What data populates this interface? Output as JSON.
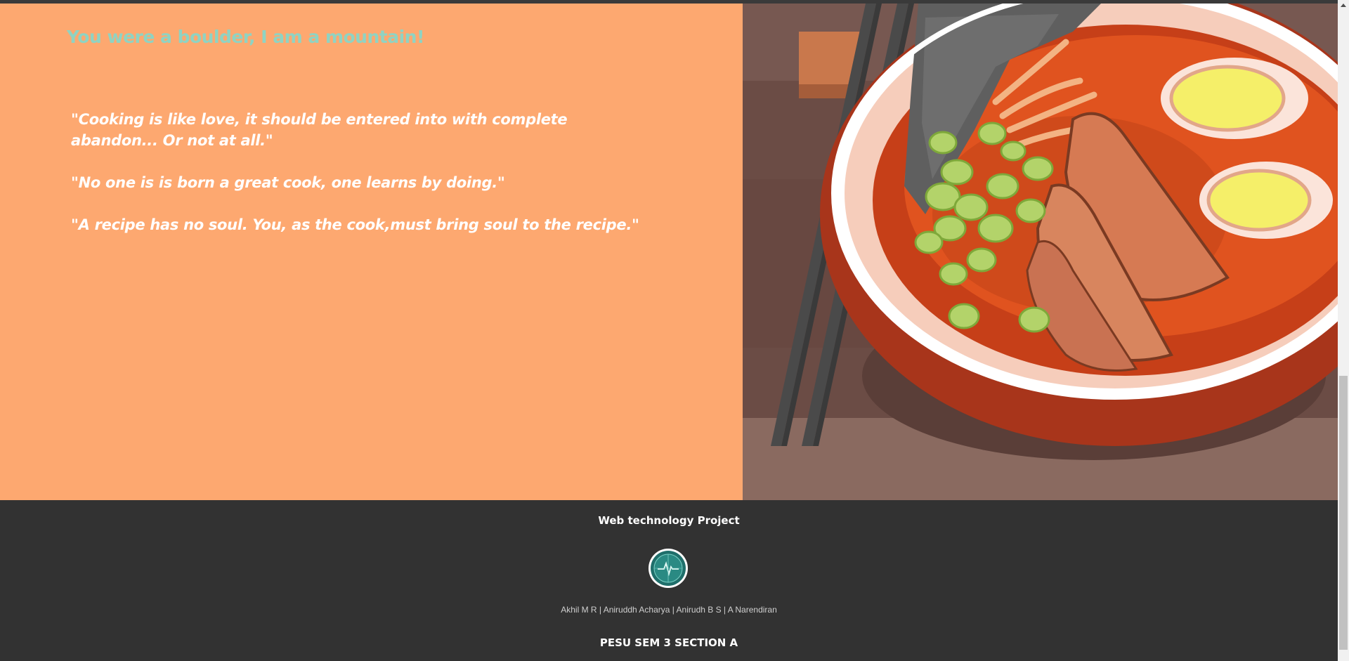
{
  "hero": {
    "headline": "You were a boulder, I am a mountain!",
    "quotes": [
      "\"Cooking is like love, it should be entered into with complete abandon... Or not at all.\"",
      "\"No one is is born a great cook, one learns by doing.\"",
      "\"A recipe has no soul. You, as the cook,must bring soul to the recipe.\""
    ],
    "image": {
      "icon": "ramen-bowl-illustration"
    }
  },
  "footer": {
    "title": "Web technology Project",
    "logo_icon": "heartbeat-globe-icon",
    "names": "Akhil M R | Aniruddh Acharya | Anirudh B S | A Narendiran",
    "section": "PESU SEM 3 SECTION A"
  },
  "colors": {
    "quote_panel_bg": "#fda870",
    "headline": "#8fd3c2",
    "quote_text": "#ffffff",
    "footer_bg": "#323232"
  }
}
